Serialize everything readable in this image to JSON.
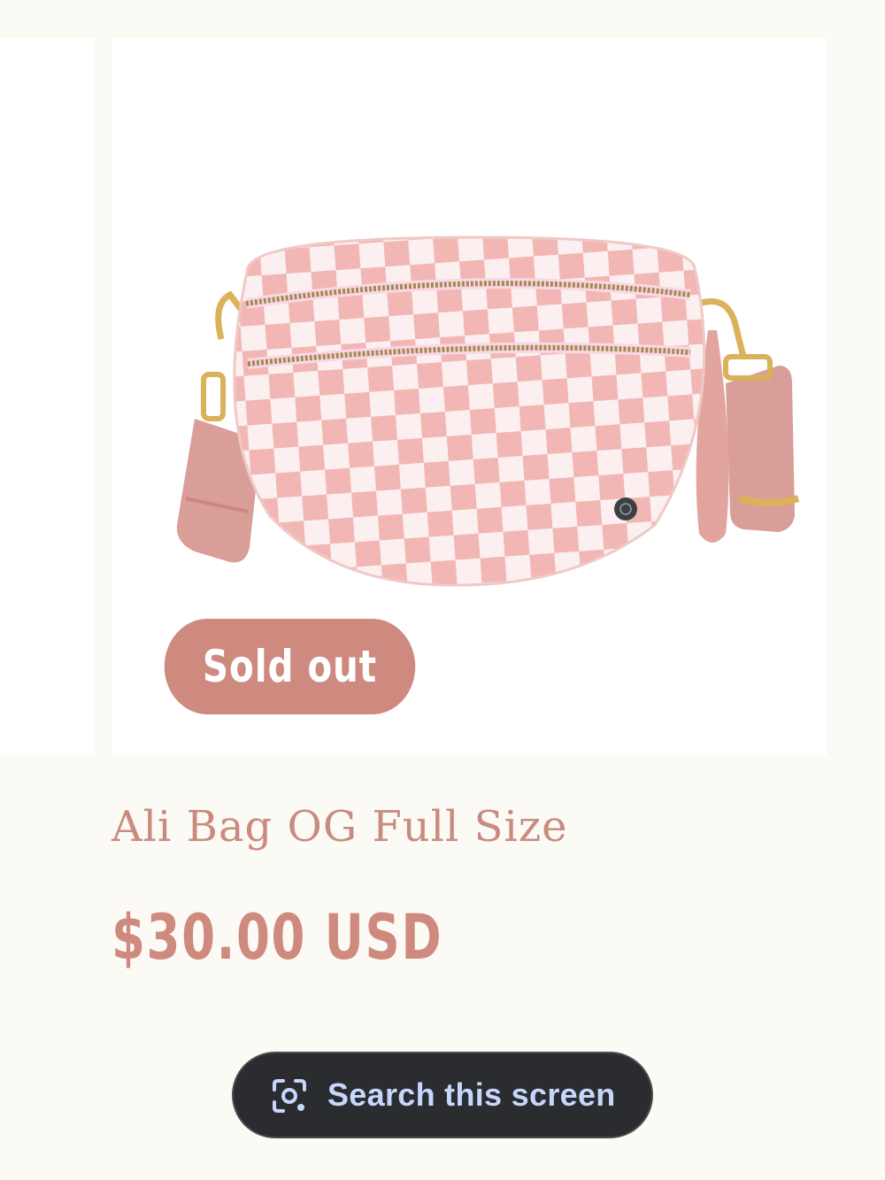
{
  "product": {
    "title": "Ali Bag OG Full Size",
    "price": "$30.00 USD",
    "badge": "Sold out",
    "image_alt": "Pink and white checkered crossbody bag with gold zippers and pink strap"
  },
  "overlay": {
    "search_label": "Search this screen"
  },
  "colors": {
    "background": "#fcfaf5",
    "accent": "#cf8a7f",
    "title": "#c98b80",
    "pill_bg": "#2a2c30",
    "pill_text": "#c7d7fb"
  },
  "icons": {
    "search": "lens-icon"
  }
}
